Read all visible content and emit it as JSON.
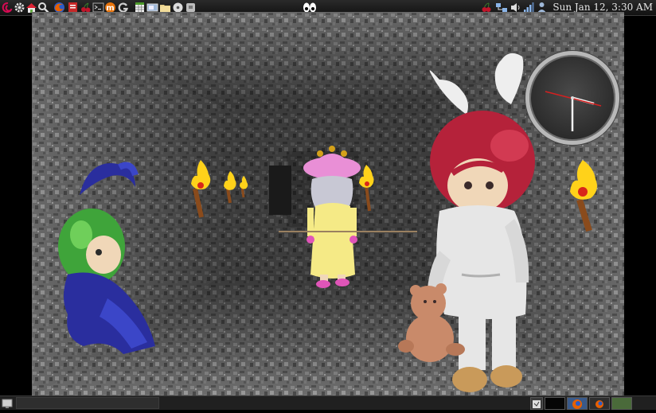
{
  "top_panel": {
    "launchers": [
      {
        "icon": "debian-swirl-icon",
        "color": "#d70a53"
      },
      {
        "icon": "gear-icon",
        "color": "#dddddd"
      },
      {
        "icon": "home-icon",
        "color": "#e0e0e0"
      },
      {
        "icon": "search-icon",
        "color": "#dddddd"
      },
      {
        "icon": "firefox-icon",
        "color": "#e66000"
      },
      {
        "icon": "pdf-reader-icon",
        "color": "#c62828"
      },
      {
        "icon": "cherry-icon",
        "color": "#c0152a"
      },
      {
        "icon": "terminal-icon",
        "color": "#333333"
      },
      {
        "icon": "mcomix-icon",
        "color": "#e8740c"
      },
      {
        "icon": "refresh-g-icon",
        "color": "#cfcfcf"
      },
      {
        "icon": "spreadsheet-icon",
        "color": "#4c9a2a"
      },
      {
        "icon": "document-viewer-icon",
        "color": "#9fb8d8"
      },
      {
        "icon": "file-manager-icon",
        "color": "#e8d08a"
      },
      {
        "icon": "disc-icon",
        "color": "#dcdcdc"
      },
      {
        "icon": "archive-icon",
        "color": "#bdbdbd"
      }
    ],
    "center_icon": "eyes-icon",
    "tray_icons": [
      "cherry-tray-icon",
      "network-icon",
      "volume-icon",
      "signal-bars-icon",
      "updates-person-icon"
    ],
    "clock": "Sun Jan 12,  3:30 AM"
  },
  "game": {
    "scene": "stone-dungeon-corridor",
    "colors": {
      "stone_light": "#8e8e8e",
      "stone_mid": "#6b6b6b",
      "stone_dark": "#3c3c3c",
      "torch_flame": "#ffd21a",
      "torch_handle": "#8a4b1c"
    },
    "characters": [
      {
        "name": "green-haired-jester",
        "hair": "#3fa43a",
        "outfit": "#2a2e9e"
      },
      {
        "name": "pink-hat-girl",
        "hat": "#e98fd6",
        "dress": "#f5ea86"
      },
      {
        "name": "bunny-eared-red-haired-girl",
        "hair": "#b5223a",
        "outfit": "#e6e6e6",
        "plush": "#c98a6a"
      }
    ]
  },
  "analog_clock": {
    "hour": 3,
    "minute": 30,
    "second_hand_color": "#d42020"
  },
  "bottom_panel": {
    "show_desktop_icon": "desktop-icon",
    "workspaces": [
      {
        "icon": "window-thumbnail-icon"
      },
      {
        "icon": "firefox-thumbnail-icon"
      },
      {
        "icon": "firefox-thumbnail-icon"
      },
      {
        "icon": "empty-workspace-icon"
      }
    ]
  }
}
